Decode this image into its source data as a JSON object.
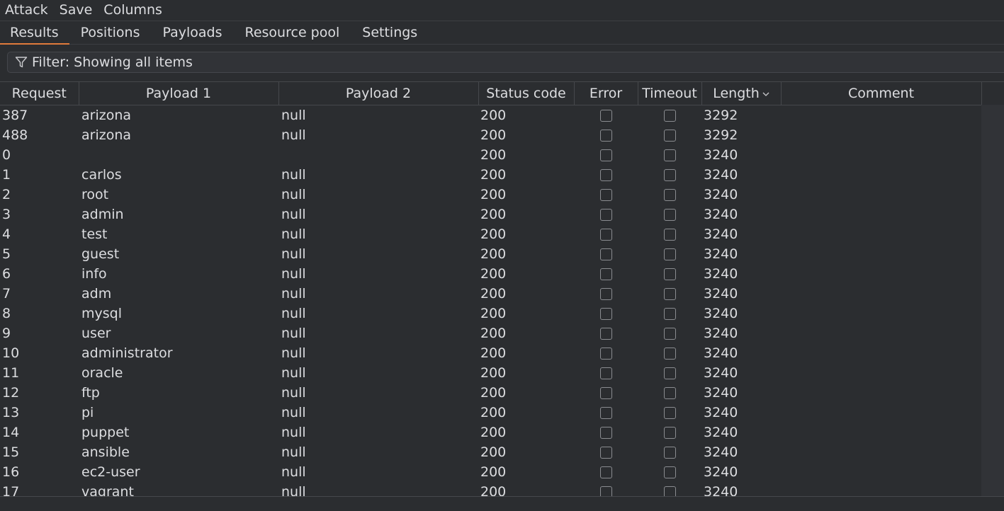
{
  "menu": [
    "Attack",
    "Save",
    "Columns"
  ],
  "tabs": [
    {
      "label": "Results",
      "active": true
    },
    {
      "label": "Positions",
      "active": false
    },
    {
      "label": "Payloads",
      "active": false
    },
    {
      "label": "Resource pool",
      "active": false
    },
    {
      "label": "Settings",
      "active": false
    }
  ],
  "filter": {
    "label": "Filter: Showing all items",
    "icon": "filter-icon"
  },
  "columns": [
    "Request",
    "Payload 1",
    "Payload 2",
    "Status code",
    "Error",
    "Timeout",
    "Length",
    "Comment"
  ],
  "sort_indicator": "chevron-down-icon",
  "rows": [
    {
      "request": "387",
      "payload1": "arizona",
      "payload2": "null",
      "status": "200",
      "error": false,
      "timeout": false,
      "length": "3292",
      "comment": ""
    },
    {
      "request": "488",
      "payload1": "arizona",
      "payload2": "null",
      "status": "200",
      "error": false,
      "timeout": false,
      "length": "3292",
      "comment": ""
    },
    {
      "request": "0",
      "payload1": "",
      "payload2": "",
      "status": "200",
      "error": false,
      "timeout": false,
      "length": "3240",
      "comment": ""
    },
    {
      "request": "1",
      "payload1": "carlos",
      "payload2": "null",
      "status": "200",
      "error": false,
      "timeout": false,
      "length": "3240",
      "comment": ""
    },
    {
      "request": "2",
      "payload1": "root",
      "payload2": "null",
      "status": "200",
      "error": false,
      "timeout": false,
      "length": "3240",
      "comment": ""
    },
    {
      "request": "3",
      "payload1": "admin",
      "payload2": "null",
      "status": "200",
      "error": false,
      "timeout": false,
      "length": "3240",
      "comment": ""
    },
    {
      "request": "4",
      "payload1": "test",
      "payload2": "null",
      "status": "200",
      "error": false,
      "timeout": false,
      "length": "3240",
      "comment": ""
    },
    {
      "request": "5",
      "payload1": "guest",
      "payload2": "null",
      "status": "200",
      "error": false,
      "timeout": false,
      "length": "3240",
      "comment": ""
    },
    {
      "request": "6",
      "payload1": "info",
      "payload2": "null",
      "status": "200",
      "error": false,
      "timeout": false,
      "length": "3240",
      "comment": ""
    },
    {
      "request": "7",
      "payload1": "adm",
      "payload2": "null",
      "status": "200",
      "error": false,
      "timeout": false,
      "length": "3240",
      "comment": ""
    },
    {
      "request": "8",
      "payload1": "mysql",
      "payload2": "null",
      "status": "200",
      "error": false,
      "timeout": false,
      "length": "3240",
      "comment": ""
    },
    {
      "request": "9",
      "payload1": "user",
      "payload2": "null",
      "status": "200",
      "error": false,
      "timeout": false,
      "length": "3240",
      "comment": ""
    },
    {
      "request": "10",
      "payload1": "administrator",
      "payload2": "null",
      "status": "200",
      "error": false,
      "timeout": false,
      "length": "3240",
      "comment": ""
    },
    {
      "request": "11",
      "payload1": "oracle",
      "payload2": "null",
      "status": "200",
      "error": false,
      "timeout": false,
      "length": "3240",
      "comment": ""
    },
    {
      "request": "12",
      "payload1": "ftp",
      "payload2": "null",
      "status": "200",
      "error": false,
      "timeout": false,
      "length": "3240",
      "comment": ""
    },
    {
      "request": "13",
      "payload1": "pi",
      "payload2": "null",
      "status": "200",
      "error": false,
      "timeout": false,
      "length": "3240",
      "comment": ""
    },
    {
      "request": "14",
      "payload1": "puppet",
      "payload2": "null",
      "status": "200",
      "error": false,
      "timeout": false,
      "length": "3240",
      "comment": ""
    },
    {
      "request": "15",
      "payload1": "ansible",
      "payload2": "null",
      "status": "200",
      "error": false,
      "timeout": false,
      "length": "3240",
      "comment": ""
    },
    {
      "request": "16",
      "payload1": "ec2-user",
      "payload2": "null",
      "status": "200",
      "error": false,
      "timeout": false,
      "length": "3240",
      "comment": ""
    },
    {
      "request": "17",
      "payload1": "vagrant",
      "payload2": "null",
      "status": "200",
      "error": false,
      "timeout": false,
      "length": "3240",
      "comment": ""
    }
  ],
  "colors": {
    "background": "#2b2d30",
    "accent": "#e07a3b",
    "text": "#dcdde0"
  }
}
